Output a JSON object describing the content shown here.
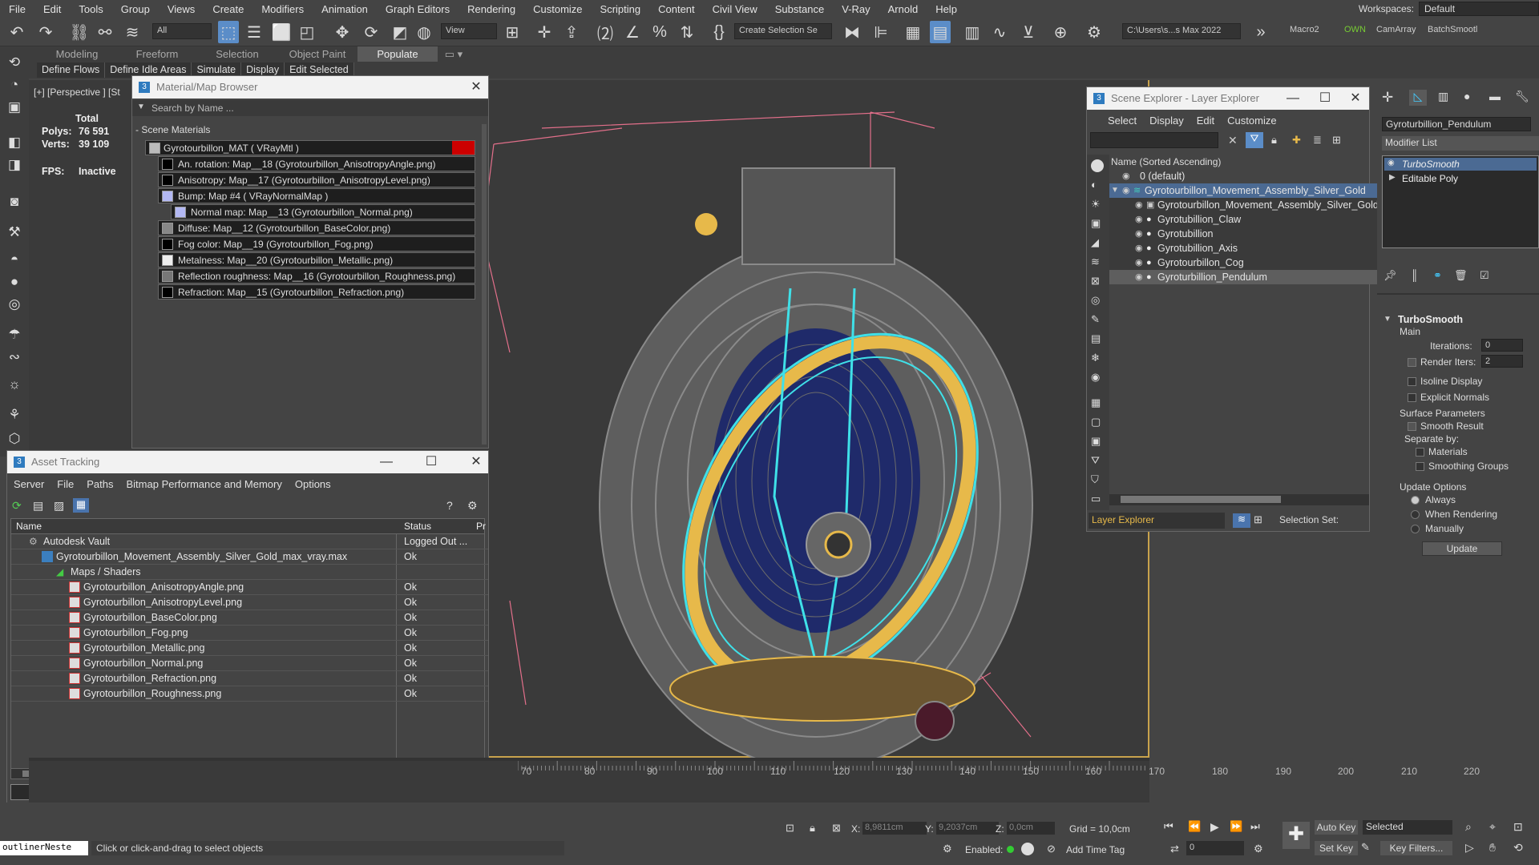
{
  "menu": [
    "File",
    "Edit",
    "Tools",
    "Group",
    "Views",
    "Create",
    "Modifiers",
    "Animation",
    "Graph Editors",
    "Rendering",
    "Customize",
    "Scripting",
    "Content",
    "Civil View",
    "Substance",
    "V-Ray",
    "Arnold",
    "Help"
  ],
  "workspaces": {
    "label": "Workspaces:",
    "value": "Default"
  },
  "toolbar": {
    "filter": "All",
    "refcoord": "View",
    "named_selection": "Create Selection Se",
    "path": "C:\\Users\\s...s Max 2022",
    "macro2": "Macro2",
    "own": "OWN",
    "camarray": "CamArray",
    "batch": "BatchSmootl"
  },
  "ribbon": {
    "tabs": [
      "Modeling",
      "Freeform",
      "Selection",
      "Object Paint",
      "Populate"
    ],
    "active_tab": "Populate",
    "sub": [
      "Define Flows",
      "Define Idle Areas",
      "Simulate",
      "Display",
      "Edit Selected"
    ]
  },
  "viewport": {
    "label": "[+] [Perspective ] [St",
    "stats": {
      "total": "Total",
      "polys_label": "Polys:",
      "polys": "76 591",
      "verts_label": "Verts:",
      "verts": "39 109",
      "fps_label": "FPS:",
      "fps": "Inactive"
    }
  },
  "material_browser": {
    "title": "Material/Map Browser",
    "search": "Search by Name ...",
    "section": "- Scene Materials",
    "rows": [
      "Gyrotourbillon_MAT ( VRayMtl )",
      "An. rotation: Map__18 (Gyrotourbillon_AnisotropyAngle.png)",
      "Anisotropy: Map__17 (Gyrotourbillon_AnisotropyLevel.png)",
      "Bump: Map #4 ( VRayNormalMap )",
      "Normal map: Map__13 (Gyrotourbillon_Normal.png)",
      "Diffuse: Map__12 (Gyrotourbillon_BaseColor.png)",
      "Fog color: Map__19 (Gyrotourbillon_Fog.png)",
      "Metalness: Map__20 (Gyrotourbillon_Metallic.png)",
      "Reflection roughness: Map__16 (Gyrotourbillon_Roughness.png)",
      "Refraction: Map__15 (Gyrotourbillon_Refraction.png)"
    ]
  },
  "asset_tracking": {
    "title": "Asset Tracking",
    "menu": [
      "Server",
      "File",
      "Paths",
      "Bitmap Performance and Memory",
      "Options"
    ],
    "columns": [
      "Name",
      "Status",
      "Pr"
    ],
    "rows": [
      {
        "name": "Autodesk Vault",
        "status": "Logged Out ..."
      },
      {
        "name": "Gyrotourbillon_Movement_Assembly_Silver_Gold_max_vray.max",
        "status": "Ok"
      },
      {
        "name": "Maps / Shaders",
        "status": ""
      },
      {
        "name": "Gyrotourbillon_AnisotropyAngle.png",
        "status": "Ok"
      },
      {
        "name": "Gyrotourbillon_AnisotropyLevel.png",
        "status": "Ok"
      },
      {
        "name": "Gyrotourbillon_BaseColor.png",
        "status": "Ok"
      },
      {
        "name": "Gyrotourbillon_Fog.png",
        "status": "Ok"
      },
      {
        "name": "Gyrotourbillon_Metallic.png",
        "status": "Ok"
      },
      {
        "name": "Gyrotourbillon_Normal.png",
        "status": "Ok"
      },
      {
        "name": "Gyrotourbillon_Refraction.png",
        "status": "Ok"
      },
      {
        "name": "Gyrotourbillon_Roughness.png",
        "status": "Ok"
      }
    ]
  },
  "scene_explorer": {
    "title": "Scene Explorer - Layer Explorer",
    "menu": [
      "Select",
      "Display",
      "Edit",
      "Customize"
    ],
    "column": "Name (Sorted Ascending)",
    "items": [
      "0 (default)",
      "Gyrotourbillon_Movement_Assembly_Silver_Gold",
      "Gyrotourbillon_Movement_Assembly_Silver_Gold",
      "Gyrotubillion_Claw",
      "Gyrotubillion",
      "Gyrotubillion_Axis",
      "Gyrotourbillon_Cog",
      "Gyroturbillion_Pendulum"
    ],
    "footer_dropdown": "Layer Explorer",
    "selection_set": "Selection Set:"
  },
  "command_panel": {
    "object_name": "Gyroturbillion_Pendulum",
    "modifier_list": "Modifier List",
    "stack": [
      "TurboSmooth",
      "Editable Poly"
    ],
    "rollout": "TurboSmooth",
    "main": "Main",
    "iterations_label": "Iterations:",
    "iterations": "0",
    "render_iters_label": "Render Iters:",
    "render_iters": "2",
    "isoline": "Isoline Display",
    "explicit": "Explicit Normals",
    "surface": "Surface Parameters",
    "smooth_result": "Smooth Result",
    "separate": "Separate by:",
    "materials": "Materials",
    "smoothing_groups": "Smoothing Groups",
    "update_options": "Update Options",
    "always": "Always",
    "when_rendering": "When Rendering",
    "manually": "Manually",
    "update_btn": "Update"
  },
  "timeline_ticks": [
    "70",
    "80",
    "90",
    "100",
    "110",
    "120",
    "130",
    "140",
    "150",
    "160",
    "170",
    "180",
    "190",
    "200",
    "210",
    "220"
  ],
  "status": {
    "script": "outlinerNeste",
    "prompt": "Click or click-and-drag to select objects",
    "x_label": "X:",
    "x": "8,9811cm",
    "y_label": "Y:",
    "y": "9,2037cm",
    "z_label": "Z:",
    "z": "0,0cm",
    "grid": "Grid = 10,0cm",
    "enabled": "Enabled:",
    "add_time_tag": "Add Time Tag",
    "autokey": "Auto Key",
    "selected": "Selected",
    "setkey": "Set Key",
    "keyfilters": "Key Filters...",
    "frame": "0"
  },
  "colors": {
    "accent": "#5b8dc8",
    "viewport_border": "#c8a24c",
    "wire_gold": "#e7b94a",
    "wire_cyan": "#3fe0e8",
    "selection_blue": "#4b6a93"
  }
}
